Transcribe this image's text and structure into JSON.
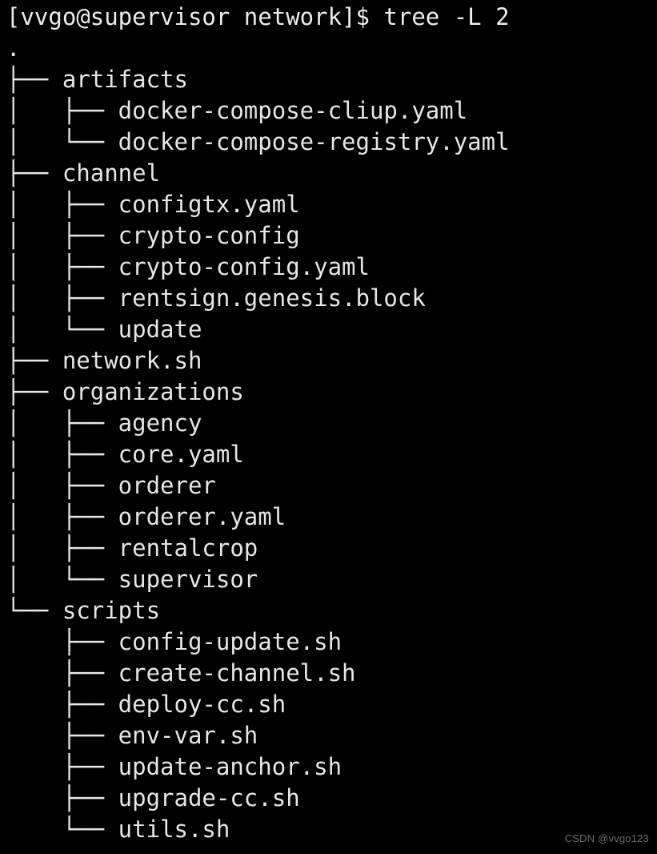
{
  "terminal": {
    "prompt": "[vvgo@supervisor network]$ tree -L 2",
    "root": ".",
    "background_color": "#000000",
    "text_color": "#e6e6e6",
    "lines": [
      "├── artifacts",
      "│   ├── docker-compose-cliup.yaml",
      "│   └── docker-compose-registry.yaml",
      "├── channel",
      "│   ├── configtx.yaml",
      "│   ├── crypto-config",
      "│   ├── crypto-config.yaml",
      "│   ├── rentsign.genesis.block",
      "│   └── update",
      "├── network.sh",
      "├── organizations",
      "│   ├── agency",
      "│   ├── core.yaml",
      "│   ├── orderer",
      "│   ├── orderer.yaml",
      "│   ├── rentalcrop",
      "│   └── supervisor",
      "└── scripts",
      "    ├── config-update.sh",
      "    ├── create-channel.sh",
      "    ├── deploy-cc.sh",
      "    ├── env-var.sh",
      "    ├── update-anchor.sh",
      "    ├── upgrade-cc.sh",
      "    └── utils.sh"
    ],
    "entries": [
      {
        "name": "artifacts",
        "depth": 1,
        "type": "directory"
      },
      {
        "name": "docker-compose-cliup.yaml",
        "depth": 2,
        "type": "file"
      },
      {
        "name": "docker-compose-registry.yaml",
        "depth": 2,
        "type": "file"
      },
      {
        "name": "channel",
        "depth": 1,
        "type": "directory"
      },
      {
        "name": "configtx.yaml",
        "depth": 2,
        "type": "file"
      },
      {
        "name": "crypto-config",
        "depth": 2,
        "type": "directory"
      },
      {
        "name": "crypto-config.yaml",
        "depth": 2,
        "type": "file"
      },
      {
        "name": "rentsign.genesis.block",
        "depth": 2,
        "type": "file"
      },
      {
        "name": "update",
        "depth": 2,
        "type": "directory"
      },
      {
        "name": "network.sh",
        "depth": 1,
        "type": "file"
      },
      {
        "name": "organizations",
        "depth": 1,
        "type": "directory"
      },
      {
        "name": "agency",
        "depth": 2,
        "type": "directory"
      },
      {
        "name": "core.yaml",
        "depth": 2,
        "type": "file"
      },
      {
        "name": "orderer",
        "depth": 2,
        "type": "directory"
      },
      {
        "name": "orderer.yaml",
        "depth": 2,
        "type": "file"
      },
      {
        "name": "rentalcrop",
        "depth": 2,
        "type": "directory"
      },
      {
        "name": "supervisor",
        "depth": 2,
        "type": "directory"
      },
      {
        "name": "scripts",
        "depth": 1,
        "type": "directory"
      },
      {
        "name": "config-update.sh",
        "depth": 2,
        "type": "file"
      },
      {
        "name": "create-channel.sh",
        "depth": 2,
        "type": "file"
      },
      {
        "name": "deploy-cc.sh",
        "depth": 2,
        "type": "file"
      },
      {
        "name": "env-var.sh",
        "depth": 2,
        "type": "file"
      },
      {
        "name": "update-anchor.sh",
        "depth": 2,
        "type": "file"
      },
      {
        "name": "upgrade-cc.sh",
        "depth": 2,
        "type": "file"
      },
      {
        "name": "utils.sh",
        "depth": 2,
        "type": "file"
      }
    ]
  },
  "watermark": {
    "text": "CSDN @vvgo123",
    "color": "#6e6e6e"
  }
}
